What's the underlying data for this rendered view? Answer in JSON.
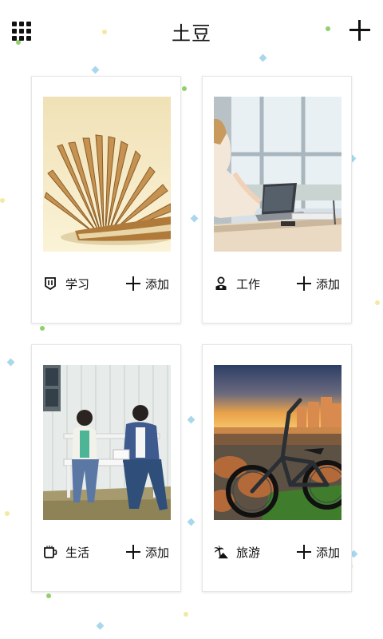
{
  "header": {
    "title": "土豆",
    "menu_icon": "grid-icon",
    "add_icon": "plus-icon"
  },
  "cards": [
    {
      "category": "学习",
      "icon": "notebook-icon",
      "add_label": "添加",
      "photo": "open-book"
    },
    {
      "category": "工作",
      "icon": "person-icon",
      "add_label": "添加",
      "photo": "laptop-desk"
    },
    {
      "category": "生活",
      "icon": "cup-icon",
      "add_label": "添加",
      "photo": "couple-bench"
    },
    {
      "category": "旅游",
      "icon": "palm-tree-icon",
      "add_label": "添加",
      "photo": "bicycle-sunset"
    }
  ],
  "colors": {
    "background": "#ffffff",
    "card_border": "#e6e6e6",
    "text": "#111111",
    "confetti": [
      "#8fd16b",
      "#f3e9a2",
      "#a9d8ec"
    ]
  }
}
